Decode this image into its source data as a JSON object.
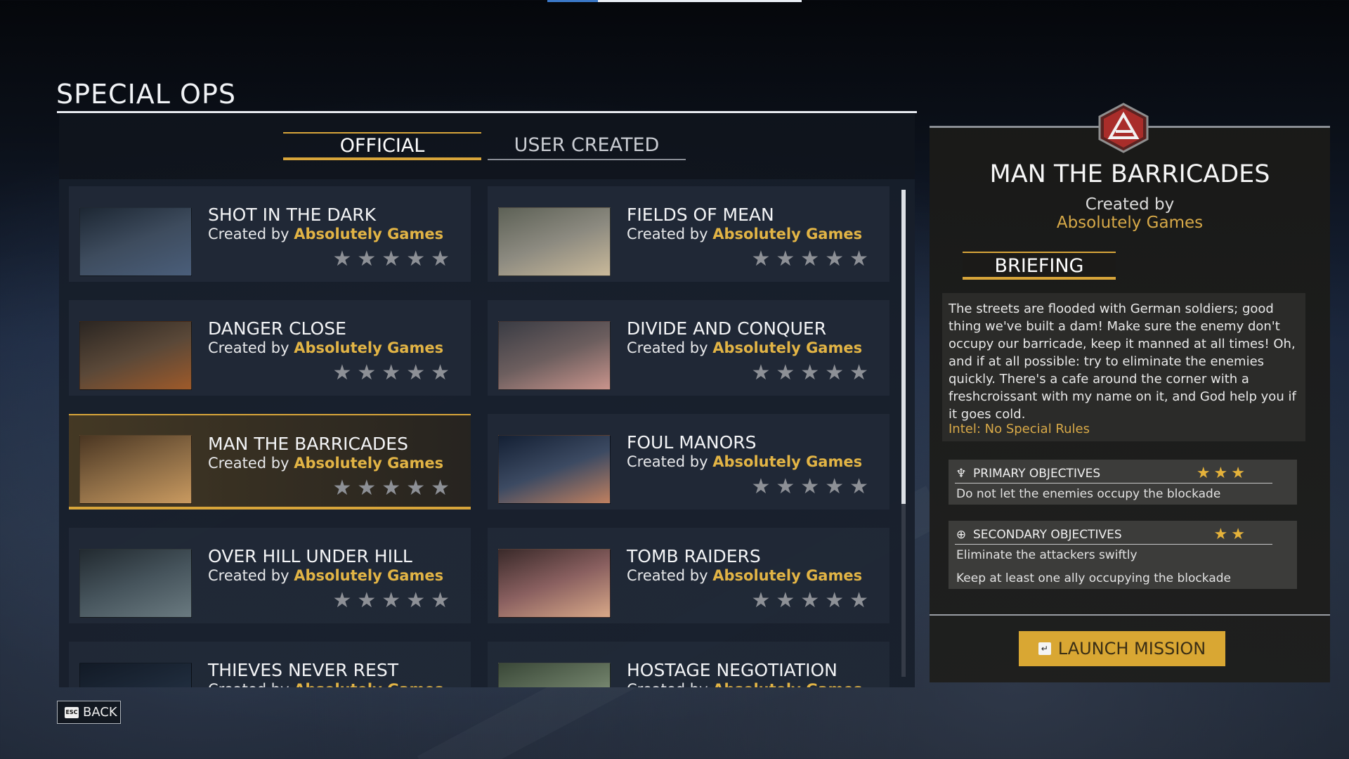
{
  "header": {
    "title": "SPECIAL OPS"
  },
  "tabs": [
    {
      "label": "OFFICIAL",
      "active": true
    },
    {
      "label": "USER CREATED",
      "active": false
    }
  ],
  "missions": [
    {
      "title": "SHOT IN THE DARK",
      "by_label": "Created by",
      "author": "Absolutely Games",
      "stars": "★★★★★",
      "thumb_colors": [
        "#1d2733",
        "#3e4c5e",
        "#4a5e7a"
      ]
    },
    {
      "title": "FIELDS OF MEAN",
      "by_label": "Created by",
      "author": "Absolutely Games",
      "stars": "★★★★★",
      "thumb_colors": [
        "#5d6156",
        "#8c8a80",
        "#c9b99a"
      ]
    },
    {
      "title": "DANGER CLOSE",
      "by_label": "Created by",
      "author": "Absolutely Games",
      "stars": "★★★★★",
      "thumb_colors": [
        "#2b2622",
        "#5a4838",
        "#9e5a2a"
      ]
    },
    {
      "title": "DIVIDE AND CONQUER",
      "by_label": "Created by",
      "author": "Absolutely Games",
      "stars": "★★★★★",
      "thumb_colors": [
        "#3a3c44",
        "#6c5e5e",
        "#c9948c"
      ]
    },
    {
      "title": "MAN THE BARRICADES",
      "by_label": "Created by",
      "author": "Absolutely Games",
      "stars": "★★★★★",
      "thumb_colors": [
        "#4a3622",
        "#8a6a44",
        "#c99a60"
      ]
    },
    {
      "title": "FOUL MANORS",
      "by_label": "Created by",
      "author": "Absolutely Games",
      "stars": "★★★★★",
      "thumb_colors": [
        "#142034",
        "#3c4a62",
        "#c08060"
      ]
    },
    {
      "title": "OVER HILL UNDER HILL",
      "by_label": "Created by",
      "author": "Absolutely Games",
      "stars": "★★★★★",
      "thumb_colors": [
        "#222a30",
        "#46545c",
        "#6a7a80"
      ]
    },
    {
      "title": "TOMB RAIDERS",
      "by_label": "Created by",
      "author": "Absolutely Games",
      "stars": "★★★★★",
      "thumb_colors": [
        "#3a2a2a",
        "#8a6060",
        "#d8a888"
      ]
    },
    {
      "title": "THIEVES NEVER REST",
      "by_label": "Created by",
      "author": "Absolutely Games",
      "stars": "★★★★★",
      "thumb_colors": [
        "#121a26",
        "#1e2a3a",
        "#2a3a50"
      ]
    },
    {
      "title": "HOSTAGE NEGOTIATION",
      "by_label": "Created by",
      "author": "Absolutely Games",
      "stars": "★★★★★",
      "thumb_colors": [
        "#3a4838",
        "#6a7a64",
        "#aab8a0"
      ]
    }
  ],
  "selected_index": 4,
  "footer": {
    "back_key": "ESC",
    "back_label": "BACK"
  },
  "detail": {
    "title": "MAN THE BARRICADES",
    "created_by": "Created by",
    "author": "Absolutely Games",
    "briefing_tab": "BRIEFING",
    "briefing": "The streets are flooded with German soldiers; good thing we've built a dam! Make sure the enemy don't occupy our barricade, keep it manned at all times! Oh, and if at all possible: try to eliminate the enemies quickly. There's a cafe around the corner with a freshcroissant with my name on it, and God help you if it goes cold.",
    "intel": "Intel: No Special Rules",
    "primary": {
      "icon": "primary-objective-icon",
      "title": "PRIMARY OBJECTIVES",
      "stars": "★★★",
      "lines": [
        "Do not let the enemies occupy the blockade"
      ]
    },
    "secondary": {
      "icon": "secondary-objective-icon",
      "title": "SECONDARY OBJECTIVES",
      "stars": "★★",
      "lines": [
        "Eliminate the attackers swiftly",
        "Keep at least one ally occupying the blockade"
      ]
    },
    "launch_label": "LAUNCH MISSION",
    "emblem_icon": "faction-emblem-icon"
  },
  "colors": {
    "accent": "#d8a53a",
    "author": "#e2b445",
    "launch": "#d9a733"
  },
  "progress": {
    "fraction": 0.2
  }
}
